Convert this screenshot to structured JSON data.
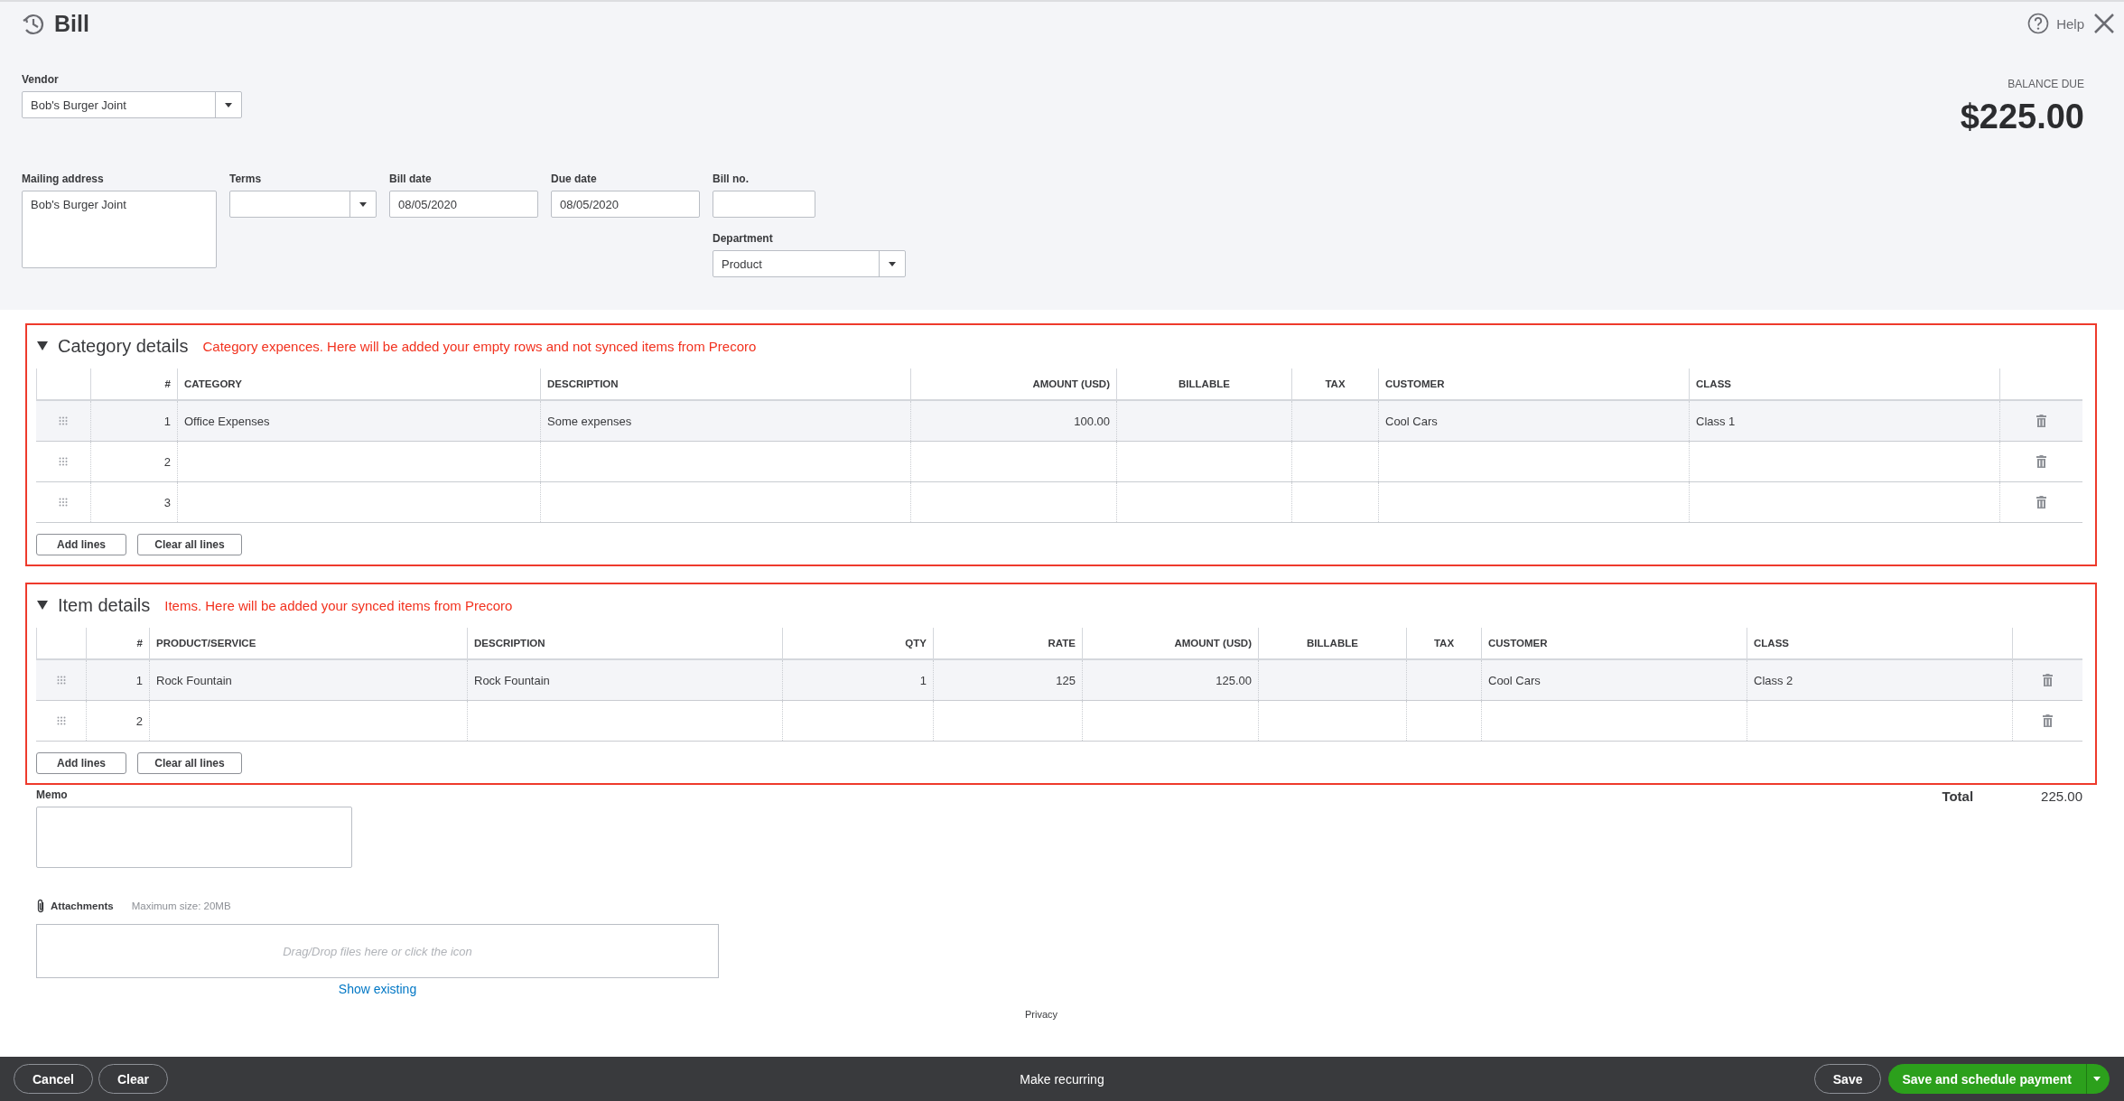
{
  "window": {
    "title": "Bill",
    "help": "Help"
  },
  "vendor": {
    "label": "Vendor",
    "value": "Bob's Burger Joint"
  },
  "balance": {
    "label": "BALANCE DUE",
    "amount": "$225.00"
  },
  "fields": [
    {
      "kind": "textarea",
      "label": "Mailing address",
      "value": "Bob's Burger Joint"
    },
    {
      "kind": "dropdown",
      "label": "Terms"
    },
    {
      "kind": "text",
      "label": "Bill date",
      "value": "08/05/2020"
    },
    {
      "kind": "text",
      "label": "Due date",
      "value": "08/05/2020"
    },
    {
      "kind": "text",
      "label": "Bill no."
    }
  ],
  "department": {
    "label": "Department",
    "value": "Product"
  },
  "sections": [
    {
      "title": "Category details",
      "expanded": true,
      "note": "Category expences. Here will be added your empty rows and not synced items from Precoro",
      "columns": [
        {
          "label": "#",
          "kind": "number"
        },
        {
          "label": "CATEGORY",
          "kind": "text"
        },
        {
          "label": "DESCRIPTION",
          "kind": "text"
        },
        {
          "label": "AMOUNT (USD)",
          "kind": "number"
        },
        {
          "label": "BILLABLE",
          "kind": "check"
        },
        {
          "label": "TAX",
          "kind": "check"
        },
        {
          "label": "CUSTOMER",
          "kind": "text"
        },
        {
          "label": "CLASS",
          "kind": "text"
        }
      ],
      "rows": [
        {
          "selected": true,
          "cells": [
            "1",
            "Office Expenses",
            "Some expenses",
            "100.00",
            null,
            null,
            "Cool Cars",
            "Class 1"
          ]
        },
        {
          "selected": false,
          "cells": [
            "2",
            null,
            null,
            null,
            null,
            null,
            null,
            null
          ]
        },
        {
          "selected": false,
          "cells": [
            "3",
            null,
            null,
            null,
            null,
            null,
            null,
            null
          ]
        }
      ],
      "buttons": [
        "Add lines",
        "Clear all lines"
      ]
    },
    {
      "title": "Item details",
      "expanded": true,
      "note": "Items. Here will be added your synced items from Precoro",
      "columns": [
        {
          "label": "#",
          "kind": "number"
        },
        {
          "label": "PRODUCT/SERVICE",
          "kind": "text"
        },
        {
          "label": "DESCRIPTION",
          "kind": "text"
        },
        {
          "label": "QTY",
          "kind": "number"
        },
        {
          "label": "RATE",
          "kind": "number"
        },
        {
          "label": "AMOUNT (USD)",
          "kind": "number"
        },
        {
          "label": "BILLABLE",
          "kind": "check"
        },
        {
          "label": "TAX",
          "kind": "check"
        },
        {
          "label": "CUSTOMER",
          "kind": "text"
        },
        {
          "label": "CLASS",
          "kind": "text"
        }
      ],
      "rows": [
        {
          "selected": true,
          "cells": [
            "1",
            "Rock Fountain",
            "Rock Fountain",
            "1",
            "125",
            "125.00",
            null,
            null,
            "Cool Cars",
            "Class 2"
          ]
        },
        {
          "selected": false,
          "cells": [
            "2",
            null,
            null,
            null,
            null,
            null,
            null,
            null,
            null,
            null
          ]
        }
      ],
      "buttons": [
        "Add lines",
        "Clear all lines"
      ]
    }
  ],
  "memo": {
    "label": "Memo"
  },
  "total": {
    "label": "Total",
    "value": "225.00"
  },
  "attachments": {
    "label": "Attachments",
    "limit": "Maximum size: 20MB",
    "drop_hint": "Drag/Drop files here or click the icon",
    "link": "Show existing"
  },
  "privacy": "Privacy",
  "actions": {
    "left": [
      "Cancel",
      "Clear"
    ],
    "center": "Make recurring",
    "right": [
      "Save",
      "Save and schedule payment"
    ]
  }
}
